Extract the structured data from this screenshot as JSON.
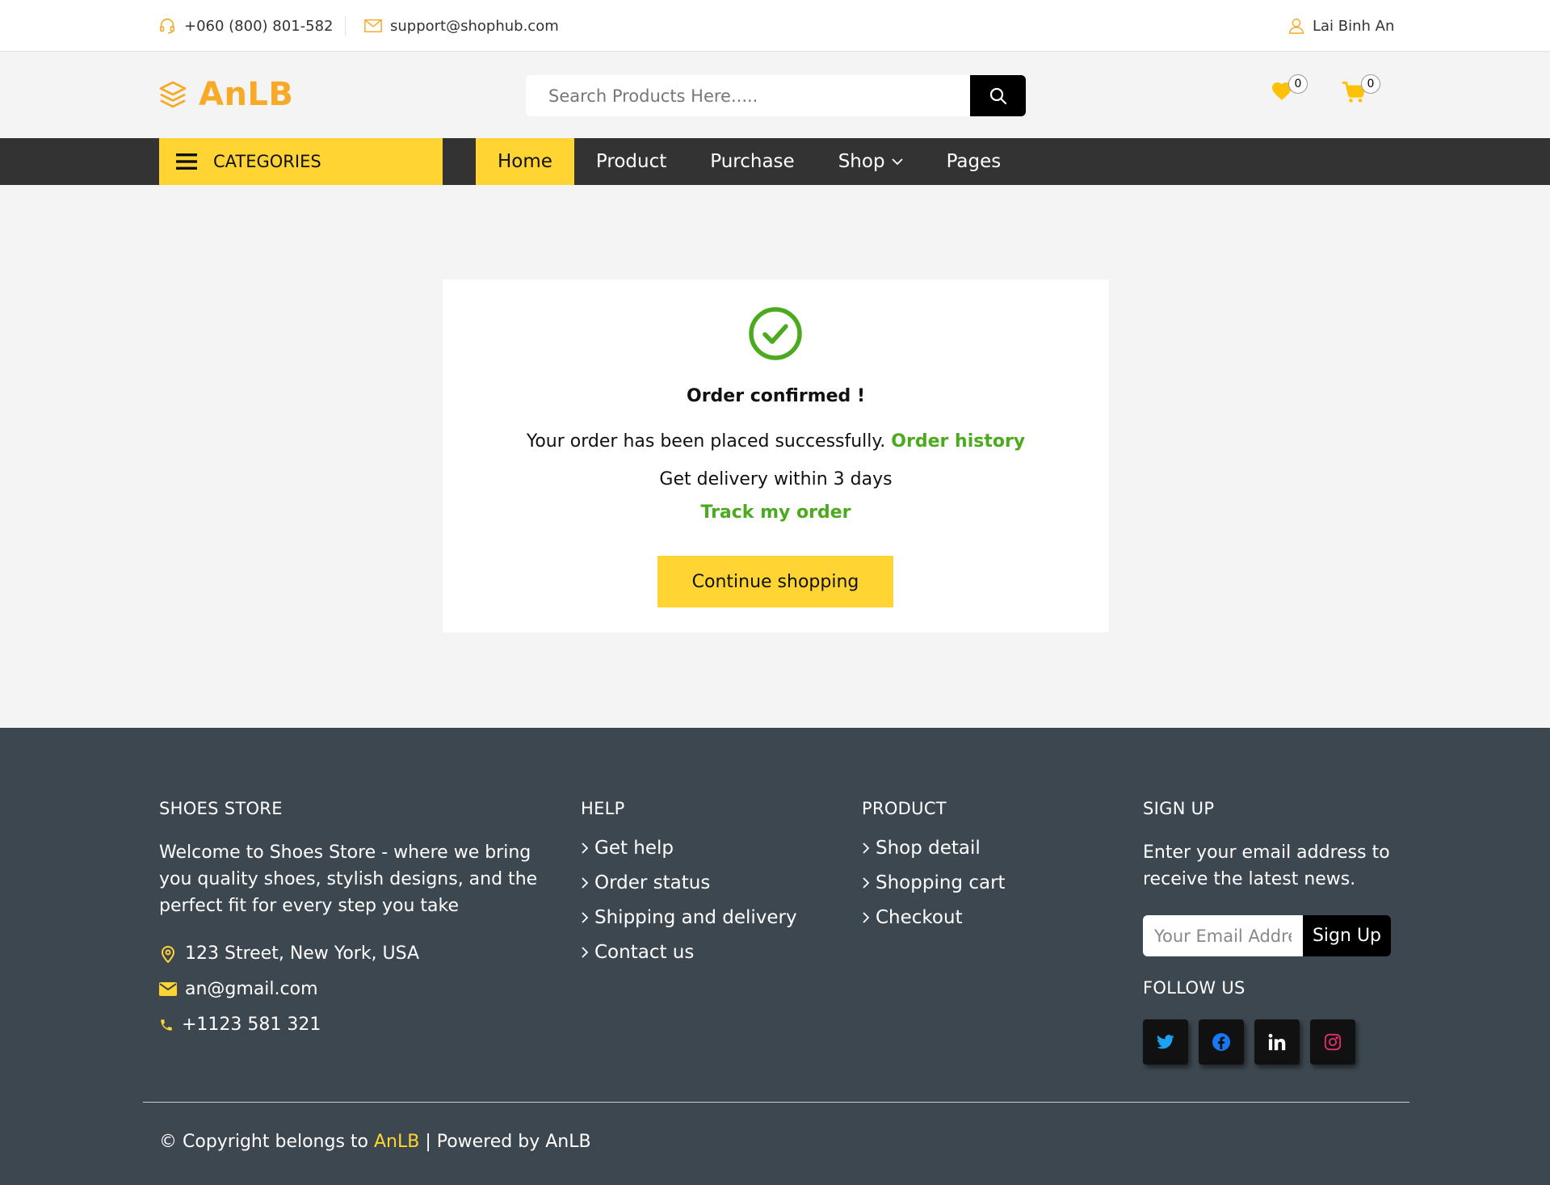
{
  "topbar": {
    "phone": "+060 (800) 801-582",
    "email": "support@shophub.com",
    "user": "Lai Binh An"
  },
  "header": {
    "logo_text": "AnLB",
    "search_placeholder": "Search Products Here.....",
    "wishlist_count": "0",
    "cart_count": "0"
  },
  "nav": {
    "categories_label": "CATEGORIES",
    "items": [
      "Home",
      "Product",
      "Purchase",
      "Shop",
      "Pages"
    ],
    "active": "Home"
  },
  "confirmation": {
    "title": "Order confirmed !",
    "message": "Your order has been placed successfully.",
    "order_history_link": "Order history",
    "delivery_text": "Get delivery within 3 days",
    "track_link": "Track my order",
    "continue_button": "Continue shopping"
  },
  "footer": {
    "store": {
      "heading": "SHOES STORE",
      "description": "Welcome to Shoes Store - where we bring you quality shoes, stylish designs, and the perfect fit for every step you take",
      "address": "123 Street, New York, USA",
      "email": "an@gmail.com",
      "phone": "+1123 581 321"
    },
    "help": {
      "heading": "HELP",
      "links": [
        "Get help",
        "Order status",
        "Shipping and delivery",
        "Contact us"
      ]
    },
    "product": {
      "heading": "PRODUCT",
      "links": [
        "Shop detail",
        "Shopping cart",
        "Checkout"
      ]
    },
    "signup": {
      "heading": "SIGN UP",
      "description": "Enter your email address to receive the latest news.",
      "email_placeholder": "Your Email Address",
      "button": "Sign Up",
      "follow_heading": "FOLLOW US",
      "socials": [
        "twitter-icon",
        "facebook-icon",
        "linkedin-icon",
        "instagram-icon"
      ]
    },
    "copyright_prefix": "© Copyright belongs to ",
    "copyright_brand": "AnLB",
    "copyright_suffix": " | Powered by AnLB"
  },
  "colors": {
    "accent_yellow": "#ffd433",
    "logo_orange": "#f7a928",
    "success_green": "#4caa1e",
    "nav_dark": "#333333",
    "footer_bg": "#3d474f"
  }
}
